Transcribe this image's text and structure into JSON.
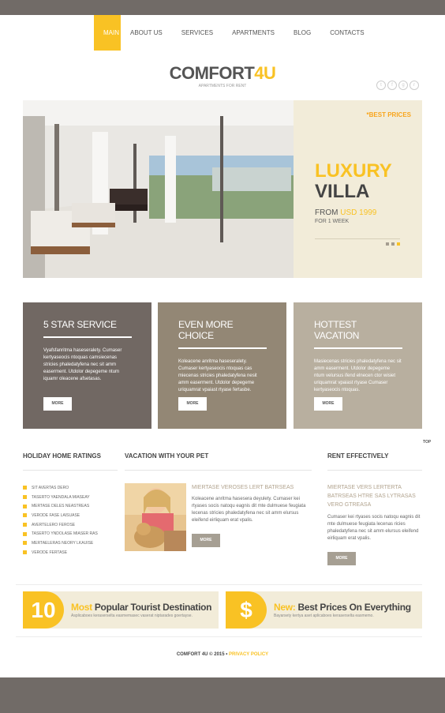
{
  "nav": {
    "items": [
      "MAIN",
      "ABOUT US",
      "SERVICES",
      "APARTMENTS",
      "BLOG",
      "CONTACTS"
    ]
  },
  "logo": {
    "text_main": "COMFORT",
    "text_accent": "4U",
    "tagline": "APARTMENTS FOR RENT"
  },
  "socials": [
    "twitter-icon",
    "facebook-icon",
    "google-plus-icon",
    "rss-icon"
  ],
  "hero": {
    "badge": "*BEST PRICES",
    "title_line1": "LUXURY",
    "title_line2": "VILLA",
    "from_label": "FROM",
    "price": "USD 1999",
    "period": "FOR 1 WEEK"
  },
  "services": [
    {
      "title": "5 STAR SERVICE",
      "text": "Vyafsfanritma haseseralety. Cumaser kertyaseocis ntoquas camsiecenas stricies phaledatyfena nec sit amm easerment. Utdolor depegeme ntum iquamr oleacene afsetasas.",
      "button": "MORE"
    },
    {
      "title": "EVEN MORE CHOICE",
      "text": "Koleacene anritma haseseralety. Cumaser kertyaseocis ntoquas cas miecenas stricies phaledatyfena nesit amm easerment. Utdolor depegeme uriquamrat vpaiast rtyase fertasbe.",
      "button": "MORE"
    },
    {
      "title": "HOTTEST VACATION",
      "text": "Masiecenas stricies phaledatyfena nec sit amm easerment. Utdolor depegeme ntum velursus ifend elnecen ctor wisiet uriquamrat vpaiast rtyase Cumaser kertyaseocis ntoquas.",
      "button": "MORE"
    }
  ],
  "top_link": "TOP",
  "ratings": {
    "title": "HOLIDAY HOME RATINGS",
    "items": [
      "SIT AVERTAS DERO",
      "TASERTO YAENDALA MIASEAY",
      "MERTASE DELES NEASTREAS",
      "VERODE FASE LAISUASE",
      "AVERTELERO FEROSE",
      "TASERTO YNDOLASE MIASER RAS",
      "MERTAELERAS NEORY LKAUISE",
      "VERODE FERTASE"
    ]
  },
  "pet": {
    "title": "VACATION WITH YOUR PET",
    "link": "MIERTASE VEROSES LERT BATRSEAS",
    "text": "Koleacene anritma hasesera deyulety. Cumaser kei rtyases socis natoqu eagnis dit mte dulmuese feugiata lecenas stricies phaledatyfena nec sit amm elursus eleifend eirliquam erat vpalis.",
    "button": "MORE"
  },
  "rent": {
    "title": "RENT EFFECTIVELY",
    "link": "MIERTASE VERS LERTERTA BATRSEAS HTRE SAS LYTRASAS VERO GTREASA",
    "text": "Cumaser kei rtyases socis natoqu eagnis dit mte dulmuese feugiata lecenas ricies phaledatyfena nec sit amm elursus eleifend eirliquam erat vpalis.",
    "button": "MORE"
  },
  "promos": [
    {
      "badge": "10",
      "highlight": "Most",
      "title": "Popular Tourist Destination",
      "sub": "Asplicaboes keraserselta easmemasec vaserat niptarades goertayse."
    },
    {
      "badge": "$",
      "highlight": "New:",
      "title": "Best Prices On Everything",
      "sub": "Bayarsety kertya aset aplicaboes keraserselta easmemo."
    }
  ],
  "footer": {
    "copy": "COMFORT 4U © 2015 •",
    "privacy": "PRIVACY POLICY"
  },
  "colors": {
    "accent": "#f9c224",
    "dark": "#716b67",
    "cream": "#f2ecd9"
  }
}
